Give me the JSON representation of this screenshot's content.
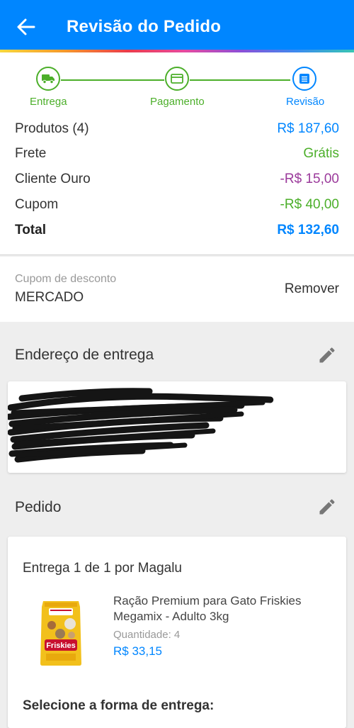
{
  "header": {
    "title": "Revisão do Pedido",
    "back_icon": "arrow-back-icon",
    "bg_color": "#0086ff"
  },
  "stepper": {
    "steps": [
      {
        "label": "Entrega",
        "icon": "truck-icon",
        "state": "done"
      },
      {
        "label": "Pagamento",
        "icon": "credit-card-icon",
        "state": "done"
      },
      {
        "label": "Revisão",
        "icon": "document-icon",
        "state": "current"
      }
    ],
    "done_color": "#4caf2a",
    "current_color": "#0086ff"
  },
  "summary": {
    "rows": [
      {
        "label": "Produtos (4)",
        "value": "R$ 187,60",
        "color": "#0086ff"
      },
      {
        "label": "Frete",
        "value": "Grátis",
        "color": "#4caf2a"
      },
      {
        "label": "Cliente Ouro",
        "value": "-R$ 15,00",
        "color": "#9b3a9b"
      },
      {
        "label": "Cupom",
        "value": "-R$ 40,00",
        "color": "#4caf2a"
      }
    ],
    "total_label": "Total",
    "total_value": "R$ 132,60"
  },
  "coupon": {
    "caption": "Cupom de desconto",
    "code": "MERCADO",
    "remove_label": "Remover"
  },
  "address": {
    "title": "Endereço de entrega",
    "edit_icon": "pencil-icon"
  },
  "order": {
    "title": "Pedido",
    "edit_icon": "pencil-icon",
    "delivery_title": "Entrega 1 de 1 por Magalu",
    "product": {
      "name": "Ração Premium para Gato Friskies Megamix - Adulto 3kg",
      "qty_label": "Quantidade:",
      "qty": "4",
      "price": "R$ 33,15",
      "image_brand": "Friskies"
    },
    "delivery_method_label": "Selecione a forma de entrega:"
  }
}
